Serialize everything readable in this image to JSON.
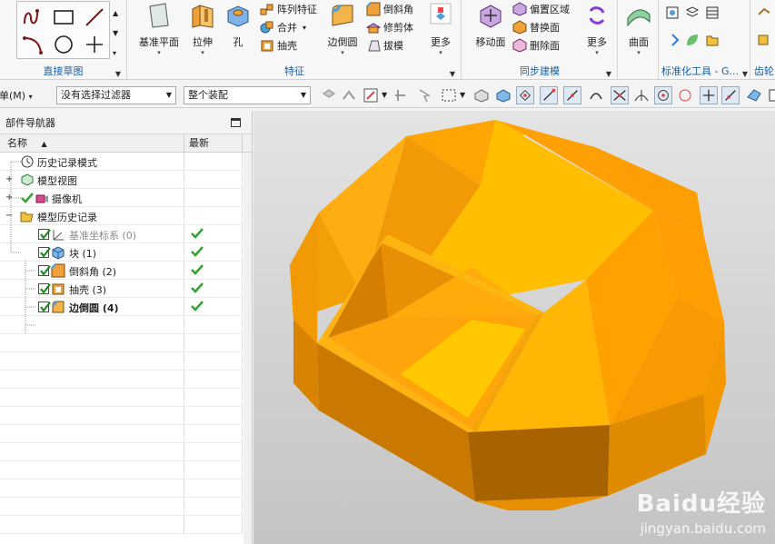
{
  "ribbon": {
    "sketch_group_label": "直接草图",
    "feature_group_label": "特征",
    "sync_group_label": "同步建模",
    "std_group_label": "标准化工具 - G...",
    "gear_group_label": "齿轮",
    "buttons": {
      "datum_plane": "基准平面",
      "extrude": "拉伸",
      "hole": "孔",
      "pattern_feature": "阵列特征",
      "unite": "合并",
      "shell": "抽壳",
      "edge_blend": "边倒圆",
      "chamfer": "倒斜角",
      "trim_body": "修剪体",
      "draft": "拔模",
      "more_feature": "更多",
      "move_face": "移动面",
      "offset_region": "偏置区域",
      "replace_face": "替换面",
      "delete_face": "删除面",
      "more_sync": "更多",
      "surface": "曲面"
    }
  },
  "selection_bar": {
    "menu_label": "菜单(M)",
    "filter_value": "没有选择过滤器",
    "assembly_scope": "整个装配"
  },
  "navigator": {
    "title": "部件导航器",
    "col_name": "名称",
    "col_latest": "最新",
    "rows": [
      {
        "label": "历史记录模式"
      },
      {
        "label": "模型视图"
      },
      {
        "label": "摄像机"
      },
      {
        "label": "模型历史记录"
      },
      {
        "label": "基准坐标系 (0)"
      },
      {
        "label": "块 (1)"
      },
      {
        "label": "倒斜角 (2)"
      },
      {
        "label": "抽壳 (3)"
      },
      {
        "label": "边倒圆 (4)"
      }
    ]
  },
  "watermark": {
    "brand": "Baidu经验",
    "url": "jingyan.baidu.com"
  },
  "colors": {
    "model_orange": "#f5a800",
    "model_top": "#ffc200",
    "ribbon_label_blue": "#1c5fa0",
    "check_green": "#2fa52f"
  }
}
